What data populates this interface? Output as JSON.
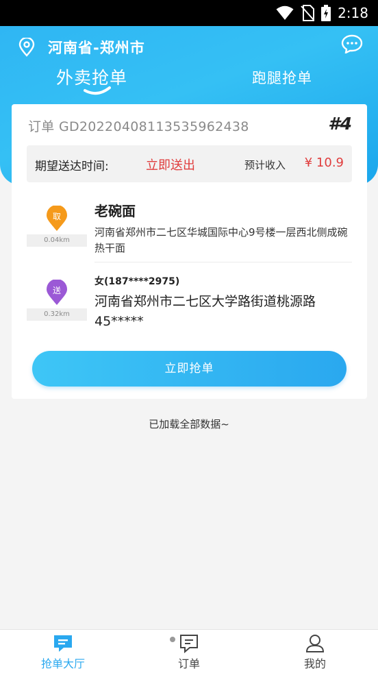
{
  "status_bar": {
    "time": "2:18"
  },
  "header": {
    "location": "河南省-郑州市"
  },
  "tabs": {
    "delivery": "外卖抢单",
    "errand": "跑腿抢单"
  },
  "order": {
    "order_no": "订单 GD20220408113535962438",
    "index": "#4",
    "expect_label": "期望送达时间:",
    "expect_value": "立即送出",
    "income_label": "预计收入",
    "income_value": "¥ 10.9",
    "pickup": {
      "badge": "取",
      "distance": "0.04km",
      "name": "老碗面",
      "address": "河南省郑州市二七区华城国际中心9号楼一层西北侧成碗热干面"
    },
    "delivery": {
      "badge": "送",
      "distance": "0.32km",
      "contact": "女(187****2975)",
      "address": "河南省郑州市二七区大学路街道桃源路45*****"
    },
    "grab_button": "立即抢单"
  },
  "footer_note": "已加载全部数据~",
  "bottom_nav": {
    "hall": "抢单大厅",
    "orders": "订单",
    "mine": "我的"
  },
  "colors": {
    "accent": "#2aa8ef",
    "price_red": "#e03c3c",
    "pickup_orange": "#f59a1b",
    "delivery_purple": "#9b59d6"
  }
}
